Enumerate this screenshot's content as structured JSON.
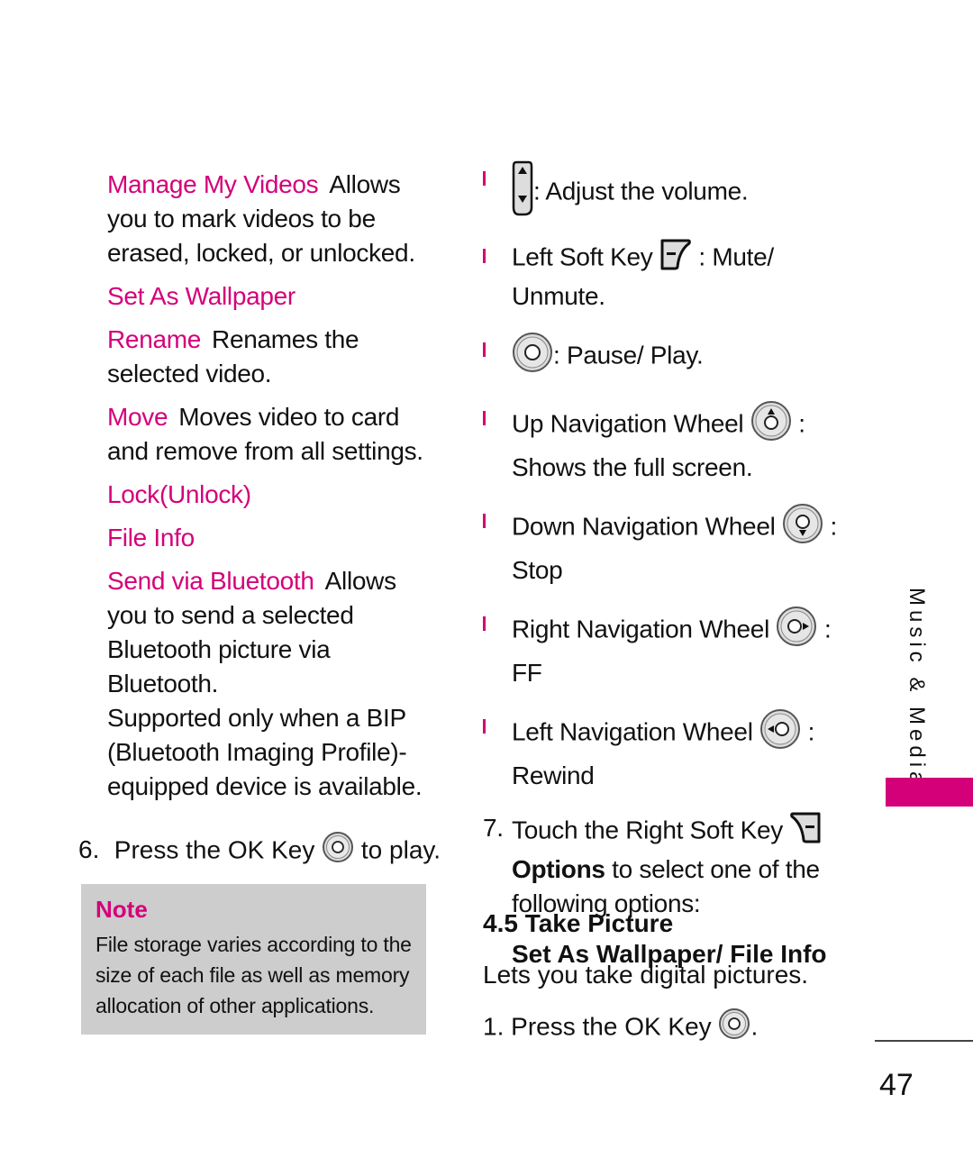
{
  "left_column": {
    "entries": [
      {
        "term": "Manage My Videos",
        "desc": "Allows you to mark videos to be erased, locked, or unlocked."
      },
      {
        "term": "Set As Wallpaper",
        "desc": ""
      },
      {
        "term": "Rename",
        "desc": "Renames the selected video."
      },
      {
        "term": "Move",
        "desc": "Moves video to card and remove from all settings."
      },
      {
        "term": "Lock(Unlock)",
        "desc": ""
      },
      {
        "term": "File Info",
        "desc": ""
      },
      {
        "term": "Send via Bluetooth",
        "desc": "Allows you to send a selected Bluetooth picture via Bluetooth."
      }
    ],
    "bluetooth_extra": "Supported only when a BIP (Bluetooth Imaging Profile)-equipped device is available.",
    "step6": {
      "number": "6.",
      "before": "Press the OK Key",
      "after": "to play.",
      "icon": "ok-key-icon"
    },
    "note": {
      "title": "Note",
      "text": "File storage varies according to the size of each file as well as memory allocation of other applications."
    }
  },
  "right_column": {
    "bullets": [
      {
        "icon": "volume-key-icon",
        "label": "",
        "desc": ": Adjust the volume."
      },
      {
        "icon": "left-soft-key-icon",
        "label": "Left Soft Key",
        "desc": ": Mute/ Unmute."
      },
      {
        "icon": "ok-key-icon",
        "label": "",
        "desc": ": Pause/ Play."
      },
      {
        "icon": "up-navigation-wheel-icon",
        "label": "Up Navigation Wheel",
        "desc": ": Shows the full screen."
      },
      {
        "icon": "down-navigation-wheel-icon",
        "label": "Down Navigation Wheel",
        "desc": ": Stop"
      },
      {
        "icon": "right-navigation-wheel-icon",
        "label": "Right Navigation Wheel",
        "desc": ": FF"
      },
      {
        "icon": "left-navigation-wheel-icon",
        "label": "Left Navigation Wheel",
        "desc": ": Rewind"
      }
    ],
    "step7": {
      "number": "7.",
      "before": "Touch the Right Soft Key",
      "icon": "right-soft-key-icon",
      "bold": "Options",
      "after": "to select one of the following options:"
    },
    "options_line": "Set As Wallpaper/ File Info",
    "section": {
      "title": "4.5 Take Picture",
      "desc": "Lets you take digital pictures.",
      "step1": {
        "number": "1.",
        "before": "Press the OK Key",
        "after": ".",
        "icon": "ok-key-icon"
      }
    }
  },
  "sidebar": {
    "label": "Music & Media"
  },
  "page_number": "47",
  "colors": {
    "accent": "#D4007A",
    "note_bg": "#CDCDCD"
  }
}
